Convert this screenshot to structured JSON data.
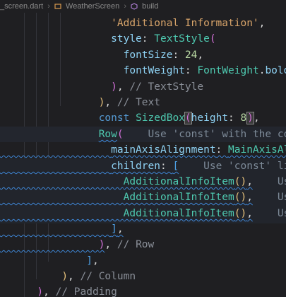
{
  "breadcrumb": {
    "file": "_screen.dart",
    "items": [
      "WeatherScreen",
      "build"
    ]
  },
  "code": {
    "l1": "'Additional Information'",
    "l2_style": "style",
    "l2_class": "TextStyle",
    "l3_prop": "fontSize",
    "l3_num": "24",
    "l4_prop": "fontWeight",
    "l4_class": "FontWeight",
    "l4_member": "bold",
    "l5_comment": "// TextStyle",
    "l6_comment": "// Text",
    "l7_kw": "const",
    "l7_class": "SizedBox",
    "l7_prop": "height",
    "l7_num": "8",
    "l8_class": "Row",
    "l8_hint": "Use 'const' with the constru",
    "l9_prop": "mainAxisAlignment",
    "l9_class": "MainAxisAlignme",
    "l10_prop": "children",
    "l10_hint": "Use 'const' literal",
    "item_class": "AdditionalInfoItem",
    "item_hint": "Use 'co",
    "l15_comment": "// Row",
    "l18_comment": "// Column",
    "l19_comment": "// Padding"
  }
}
